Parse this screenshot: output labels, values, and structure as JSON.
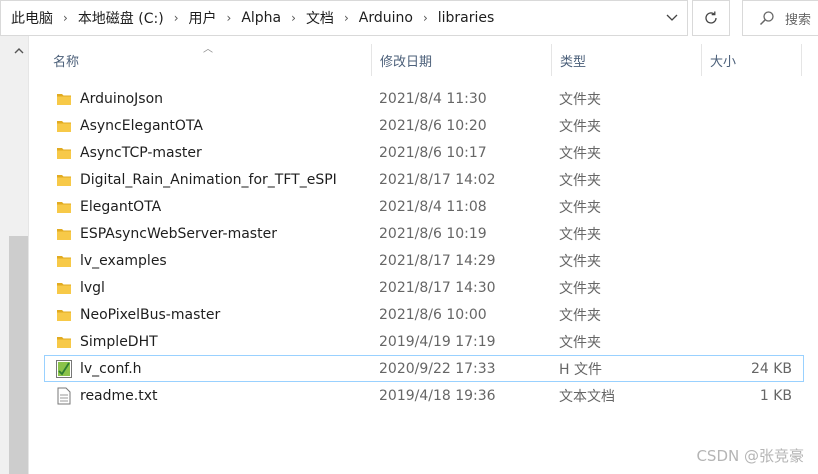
{
  "address": {
    "crumbs": [
      "此电脑",
      "本地磁盘 (C:)",
      "用户",
      "Alpha",
      "文档",
      "Arduino",
      "libraries"
    ],
    "search_placeholder": "搜索"
  },
  "columns": {
    "name": "名称",
    "date": "修改日期",
    "type": "类型",
    "size": "大小"
  },
  "files": [
    {
      "name": "ArduinoJson",
      "date": "2021/8/4 11:30",
      "type": "文件夹",
      "size": "",
      "icon": "folder-icon"
    },
    {
      "name": "AsyncElegantOTA",
      "date": "2021/8/6 10:20",
      "type": "文件夹",
      "size": "",
      "icon": "folder-icon"
    },
    {
      "name": "AsyncTCP-master",
      "date": "2021/8/6 10:17",
      "type": "文件夹",
      "size": "",
      "icon": "folder-icon"
    },
    {
      "name": "Digital_Rain_Animation_for_TFT_eSPI",
      "date": "2021/8/17 14:02",
      "type": "文件夹",
      "size": "",
      "icon": "folder-icon"
    },
    {
      "name": "ElegantOTA",
      "date": "2021/8/4 11:08",
      "type": "文件夹",
      "size": "",
      "icon": "folder-icon"
    },
    {
      "name": "ESPAsyncWebServer-master",
      "date": "2021/8/6 10:19",
      "type": "文件夹",
      "size": "",
      "icon": "folder-icon"
    },
    {
      "name": "lv_examples",
      "date": "2021/8/17 14:29",
      "type": "文件夹",
      "size": "",
      "icon": "folder-icon"
    },
    {
      "name": "lvgl",
      "date": "2021/8/17 14:30",
      "type": "文件夹",
      "size": "",
      "icon": "folder-icon"
    },
    {
      "name": "NeoPixelBus-master",
      "date": "2021/8/6 10:00",
      "type": "文件夹",
      "size": "",
      "icon": "folder-icon"
    },
    {
      "name": "SimpleDHT",
      "date": "2019/4/19 17:19",
      "type": "文件夹",
      "size": "",
      "icon": "folder-icon"
    },
    {
      "name": "lv_conf.h",
      "date": "2020/9/22 17:33",
      "type": "H 文件",
      "size": "24 KB",
      "icon": "header-file-icon",
      "selected": true
    },
    {
      "name": "readme.txt",
      "date": "2019/4/18 19:36",
      "type": "文本文档",
      "size": "1 KB",
      "icon": "text-file-icon"
    }
  ],
  "watermark": "CSDN @张竞豪",
  "colors": {
    "folder": "#f7c948",
    "folder_dark": "#e2ab21",
    "selection_border": "#99d1ff",
    "header_text": "#4c607a"
  }
}
